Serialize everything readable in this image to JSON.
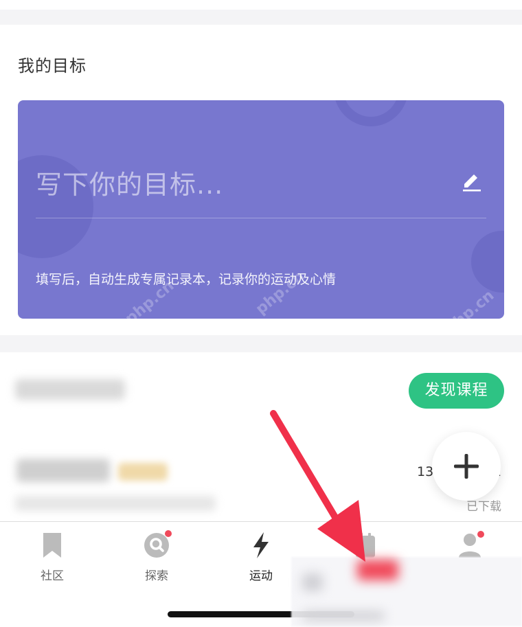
{
  "goals": {
    "section_title": "我的目标",
    "placeholder": "写下你的目标...",
    "hint": "填写后，自动生成专属记录本，记录你的运动及心情"
  },
  "courses": {
    "discover_label": "发现课程",
    "date_text": "13",
    "date_suffix": "2",
    "downloaded_label": "已下载"
  },
  "fab": {
    "icon": "plus-icon"
  },
  "tabs": [
    {
      "label": "社区",
      "icon": "bookmark-icon",
      "badge": false,
      "active": false
    },
    {
      "label": "探索",
      "icon": "explore-icon",
      "badge": true,
      "active": false
    },
    {
      "label": "运动",
      "icon": "lightning-icon",
      "badge": false,
      "active": true
    },
    {
      "label": "",
      "icon": "calendar-icon",
      "badge": false,
      "active": false
    },
    {
      "label": "",
      "icon": "profile-icon",
      "badge": true,
      "active": false
    }
  ],
  "watermark_text": "php.cn",
  "colors": {
    "goal_card": "#7877cf",
    "discover_button": "#2ec384",
    "badge": "#f04a5b",
    "annotation_arrow": "#f0304a"
  }
}
